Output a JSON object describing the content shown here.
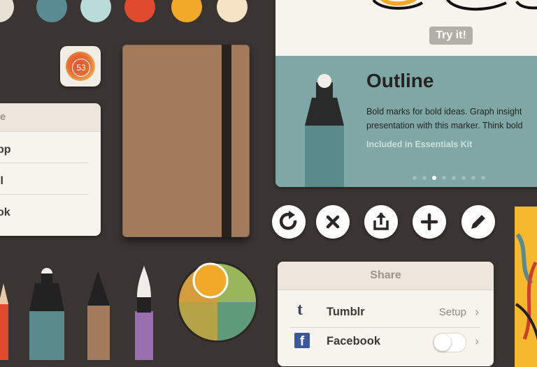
{
  "palette": {
    "swatches": [
      "#e9e1d6",
      "#5a8a92",
      "#b9dcd9",
      "#e04a2e",
      "#f2a92a",
      "#f6e2c4"
    ]
  },
  "app_icon": {
    "badge_number": "53"
  },
  "left_panel": {
    "title": "re",
    "rows": [
      "pp",
      "il",
      "ok"
    ]
  },
  "try_card": {
    "try_label": "Try it!",
    "title": "Outline",
    "description_line1": "Bold marks for bold ideas. Graph insight",
    "description_line2": "presentation with this marker. Think bold",
    "kit": "Included in Essentials Kit",
    "page_count": 8,
    "active_page": 3
  },
  "toolbar": {
    "icons": [
      "rotate-icon",
      "close-icon",
      "share-icon",
      "plus-icon",
      "pencil-icon"
    ]
  },
  "share_panel": {
    "title": "Share",
    "tumblr": {
      "label": "Tumblr",
      "action": "Setup"
    },
    "facebook": {
      "label": "Facebook",
      "enabled": false
    }
  },
  "colors": {
    "background": "#3a3532",
    "teal": "#7fa7a6",
    "notebook": "#a27a5c",
    "mixer_selected": "#f2a92a"
  }
}
